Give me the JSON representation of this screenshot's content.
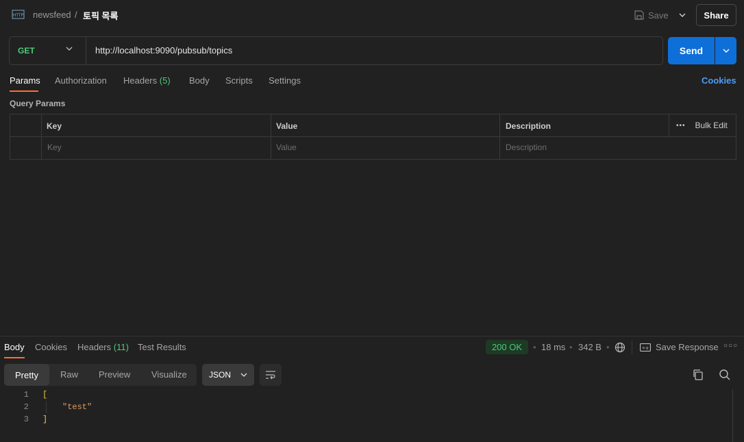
{
  "header": {
    "collection": "newsfeed",
    "separator": "/",
    "request_title": "토픽 목록",
    "save_label": "Save",
    "share_label": "Share"
  },
  "request": {
    "method": "GET",
    "url": "http://localhost:9090/pubsub/topics",
    "send_label": "Send"
  },
  "request_tabs": {
    "params": "Params",
    "authorization": "Authorization",
    "headers": "Headers",
    "headers_count": "(5)",
    "body": "Body",
    "scripts": "Scripts",
    "settings": "Settings",
    "cookies": "Cookies"
  },
  "query_params": {
    "label": "Query Params",
    "columns": {
      "key": "Key",
      "value": "Value",
      "description": "Description"
    },
    "bulk_edit": "Bulk Edit",
    "placeholders": {
      "key": "Key",
      "value": "Value",
      "description": "Description"
    }
  },
  "response_tabs": {
    "body": "Body",
    "cookies": "Cookies",
    "headers": "Headers",
    "headers_count": "(11)",
    "test_results": "Test Results"
  },
  "response_meta": {
    "status": "200 OK",
    "time": "18 ms",
    "size": "342 B",
    "save_response": "Save Response"
  },
  "view_modes": {
    "pretty": "Pretty",
    "raw": "Raw",
    "preview": "Preview",
    "visualize": "Visualize",
    "format": "JSON"
  },
  "code_lines": [
    {
      "num": "1",
      "text": "["
    },
    {
      "num": "2",
      "text": "\"test\""
    },
    {
      "num": "3",
      "text": "]"
    }
  ],
  "colors": {
    "accent_orange": "#ff6c37",
    "send_blue": "#0f6fd9",
    "success_green": "#4ec97a",
    "link_blue": "#4d9ef5"
  }
}
